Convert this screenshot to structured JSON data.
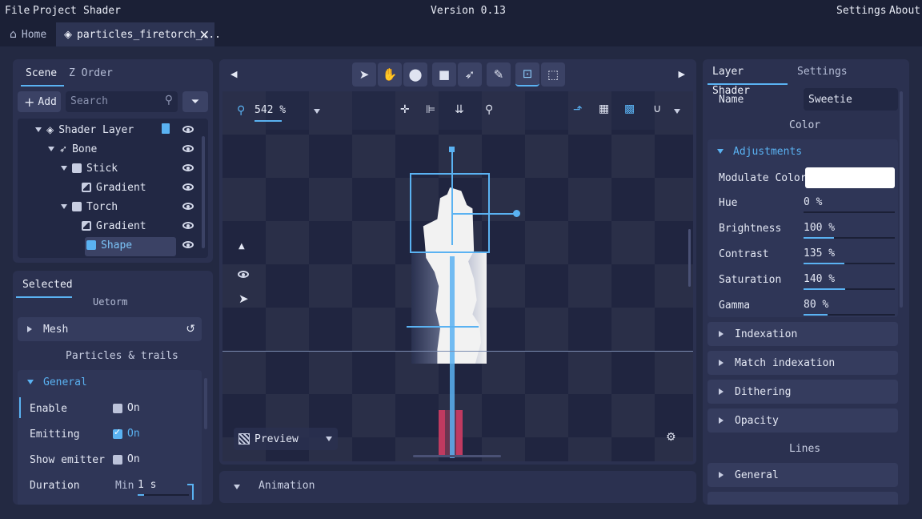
{
  "menu": {
    "file": "File",
    "project": "Project",
    "shader": "Shader",
    "version": "Version 0.13",
    "settings": "Settings",
    "about": "About"
  },
  "tabs": {
    "home": "Home",
    "file": "particles_firetorch_..."
  },
  "scene_panel": {
    "tab_scene": "Scene",
    "tab_zorder": "Z Order",
    "add_label": "Add",
    "search_placeholder": "Search",
    "tree": [
      {
        "label": "Shader Layer"
      },
      {
        "label": "Bone"
      },
      {
        "label": "Stick"
      },
      {
        "label": "Gradient"
      },
      {
        "label": "Torch"
      },
      {
        "label": "Gradient"
      },
      {
        "label": "Shape"
      }
    ]
  },
  "selected_panel": {
    "tab": "Selected",
    "cut_label": "Uetorm",
    "mesh": "Mesh",
    "particles_header": "Particles & trails",
    "general": "General",
    "enable": {
      "label": "Enable",
      "value": "On",
      "checked": false
    },
    "emitting": {
      "label": "Emitting",
      "value": "On",
      "checked": true
    },
    "show_emitter": {
      "label": "Show emitter",
      "value": "On",
      "checked": false
    },
    "duration": {
      "label": "Duration",
      "min_label": "Min",
      "value": "1 s"
    }
  },
  "viewport": {
    "zoom": "542 %",
    "preview": "Preview",
    "animation": "Animation"
  },
  "right_panel": {
    "tab_layer_shader": "Layer Shader",
    "tab_settings": "Settings",
    "name_label": "Name",
    "name_value": "Sweetie",
    "color_header": "Color",
    "adjustments": "Adjustments",
    "modulate_label": "Modulate Color",
    "modulate_color": "#ffffff",
    "sliders": [
      {
        "label": "Hue",
        "value": "0 %",
        "fraction": 0.0
      },
      {
        "label": "Brightness",
        "value": "100 %",
        "fraction": 0.33
      },
      {
        "label": "Contrast",
        "value": "135 %",
        "fraction": 0.45
      },
      {
        "label": "Saturation",
        "value": "140 %",
        "fraction": 0.46
      },
      {
        "label": "Gamma",
        "value": "80 %",
        "fraction": 0.26
      }
    ],
    "sections": [
      "Indexation",
      "Match indexation",
      "Dithering",
      "Opacity"
    ],
    "lines_header": "Lines",
    "lines_general": "General"
  },
  "colors": {
    "accent": "#5ab2f2",
    "panel": "#2b3150",
    "background": "#232942"
  }
}
